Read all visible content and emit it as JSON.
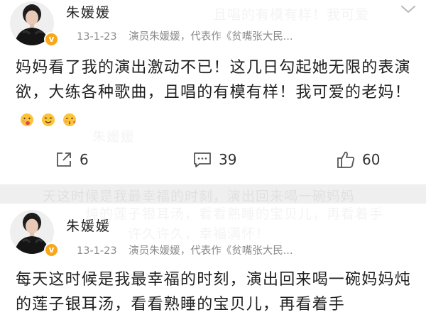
{
  "posts": [
    {
      "username": "朱媛媛",
      "date": "13-1-23",
      "source": "演员朱媛媛，代表作《贫嘴张大民...",
      "content": "妈妈看了我的演出激动不已！这几日勾起她无限的表演欲，大练各种歌曲，且唱的有模有样！我可爱的老妈！",
      "emojis": [
        "tongue-face",
        "smiling-face",
        "blowing-kiss-face"
      ],
      "actions": {
        "repost": "6",
        "comment": "39",
        "like": "60"
      }
    },
    {
      "username": "朱媛媛",
      "date": "13-1-23",
      "source": "演员朱媛媛，代表作《贫嘴张大民...",
      "content": "每天这时候是我最幸福的时刻，演出回来喝一碗妈妈炖的莲子银耳汤，看看熟睡的宝贝儿，再看着手"
    }
  ],
  "colors": {
    "username": "#222222",
    "meta": "#8a8a8a",
    "content": "#1f1f1f",
    "verified_badge": "#f7a71a",
    "divider": "#efefef"
  }
}
